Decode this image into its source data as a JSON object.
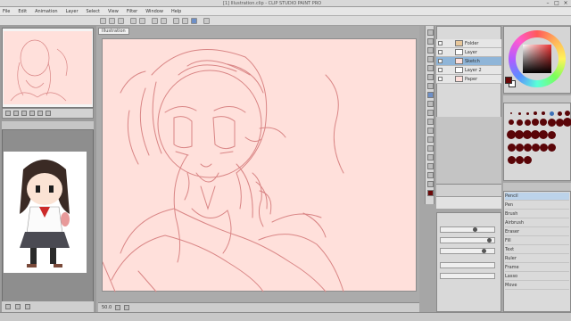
{
  "titlebar": {
    "title": "[1] Illustration.clip - CLIP STUDIO PAINT PRO"
  },
  "menubar": {
    "items": [
      "File",
      "Edit",
      "Animation",
      "Layer",
      "Select",
      "View",
      "Filter",
      "Window",
      "Help"
    ]
  },
  "canvas": {
    "tabs": [
      "Illustration"
    ],
    "zoom": "50.0"
  },
  "layers": {
    "rows": [
      "Folder",
      "Layer",
      "Sketch",
      "Layer 2",
      "Paper"
    ]
  },
  "toollist": {
    "rows": [
      "Pencil",
      "Pen",
      "Brush",
      "Airbrush",
      "Eraser",
      "Fill",
      "Text",
      "Ruler",
      "Frame",
      "Lasso",
      "Move"
    ]
  },
  "colors": {
    "canvas": "#ffe0db",
    "sketch": "#d98585",
    "main_color": "#6b0909",
    "sub_color": "#ffffff",
    "selected_layer": "#8fb5d8"
  }
}
